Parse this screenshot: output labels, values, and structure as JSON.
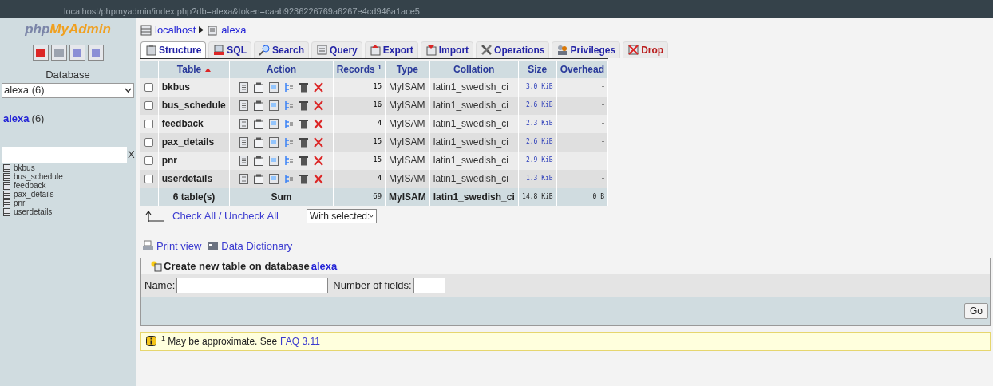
{
  "browser": {
    "url": "localhost/phpmyadmin/index.php?db=alexa&token=caab9236226769a6267e4cd946a1ace5"
  },
  "sidebar": {
    "logo_a": "php",
    "logo_b": "MyAdmin",
    "database_label": "Database",
    "database_select": "alexa (6)",
    "db_link": "alexa",
    "db_count": "(6)",
    "filter_clear": "X",
    "tables": [
      "bkbus",
      "bus_schedule",
      "feedback",
      "pax_details",
      "pnr",
      "userdetails"
    ]
  },
  "breadcrumb": [
    "localhost",
    "alexa"
  ],
  "tabs": [
    {
      "label": "Structure",
      "kind": "structure",
      "selected": true
    },
    {
      "label": "SQL",
      "kind": "sql",
      "selected": false
    },
    {
      "label": "Search",
      "kind": "search",
      "selected": false
    },
    {
      "label": "Query",
      "kind": "query",
      "selected": false
    },
    {
      "label": "Export",
      "kind": "export",
      "selected": false
    },
    {
      "label": "Import",
      "kind": "import",
      "selected": false
    },
    {
      "label": "Operations",
      "kind": "operations",
      "selected": false
    },
    {
      "label": "Privileges",
      "kind": "privileges",
      "selected": false
    },
    {
      "label": "Drop",
      "kind": "drop",
      "selected": false
    }
  ],
  "table": {
    "columns": [
      "Table",
      "Action",
      "Records $^{1}$",
      "Type",
      "Collation",
      "Size",
      "Overhead"
    ],
    "rows": [
      {
        "name": "bkbus",
        "records": "15",
        "type": "MyISAM",
        "collation": "latin1_swedish_ci",
        "size": "3.0 KiB",
        "overhead": "-",
        "checked": false
      },
      {
        "name": "bus_schedule",
        "records": "16",
        "type": "MyISAM",
        "collation": "latin1_swedish_ci",
        "size": "2.6 KiB",
        "overhead": "-",
        "checked": false
      },
      {
        "name": "feedback",
        "records": "4",
        "type": "MyISAM",
        "collation": "latin1_swedish_ci",
        "size": "2.3 KiB",
        "overhead": "-",
        "checked": false
      },
      {
        "name": "pax_details",
        "records": "15",
        "type": "MyISAM",
        "collation": "latin1_swedish_ci",
        "size": "2.6 KiB",
        "overhead": "-",
        "checked": false
      },
      {
        "name": "pnr",
        "records": "15",
        "type": "MyISAM",
        "collation": "latin1_swedish_ci",
        "size": "2.9 KiB",
        "overhead": "-",
        "checked": false
      },
      {
        "name": "userdetails",
        "records": "4",
        "type": "MyISAM",
        "collation": "latin1_swedish_ci",
        "size": "1.3 KiB",
        "overhead": "-",
        "checked": false
      }
    ],
    "footer": {
      "name": "6 table(s)",
      "action": "Sum",
      "records": "69",
      "type": "MyISAM",
      "collation": "latin1_swedish_ci",
      "size": "14.8 KiB",
      "overhead": "0 B"
    }
  },
  "check_all": "Check All / Uncheck All",
  "with_selected": "With selected:",
  "links": [
    {
      "label": "Print view",
      "kind": "print"
    },
    {
      "label": "Data Dictionary",
      "kind": "dictionary"
    }
  ],
  "create": {
    "legend": "Create new table on database",
    "db": "alexa",
    "name_label": "Name:",
    "fields_label": "Number of fields:",
    "go": "Go"
  },
  "notice": {
    "mark": "1",
    "text": "May be approximate. See",
    "link": "FAQ 3.11"
  }
}
